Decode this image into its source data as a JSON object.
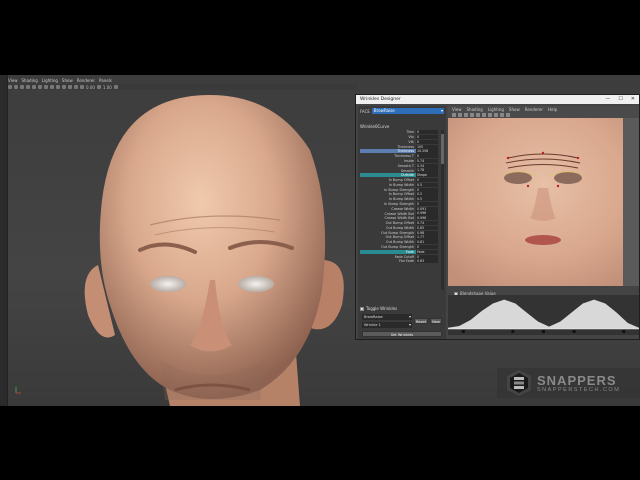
{
  "maya": {
    "menu": [
      "View",
      "Shading",
      "Lighting",
      "Show",
      "Renderer",
      "Panels"
    ],
    "toolbar_values": [
      "0.00",
      "1.00"
    ]
  },
  "designer": {
    "title": "Wrinkles Designer",
    "window_controls": [
      "—",
      "☐",
      "✕"
    ],
    "face_label": "FACE",
    "face_value": "BrowRaise",
    "wrinkles_header": "Wrinkle0Curve",
    "attributes": [
      {
        "name": "Tilex",
        "value": "0"
      },
      {
        "name": "Vtx",
        "value": "0"
      },
      {
        "name": "Vtk",
        "value": "0"
      },
      {
        "name": "Thickness",
        "value": "105"
      },
      {
        "name": "Thickness",
        "value": "10.256",
        "hl": true
      },
      {
        "name": "Thickness T",
        "value": "0"
      },
      {
        "name": "Inside",
        "value": "0.74"
      },
      {
        "name": "Smooth T",
        "value": "0.34"
      },
      {
        "name": "Smooth",
        "value": "1.78"
      },
      {
        "name": "Outside",
        "value": "Shape",
        "sec": true
      },
      {
        "name": "In Bump Offset",
        "value": "0"
      },
      {
        "name": "In Bump Width",
        "value": "0.5"
      },
      {
        "name": "In Bump Strength",
        "value": "0"
      },
      {
        "name": "In Bump Offset",
        "value": "0.2"
      },
      {
        "name": "In Bump Width",
        "value": "0.5"
      },
      {
        "name": "In Bump Strength",
        "value": "0"
      },
      {
        "name": "Crease Width",
        "value": "0.091"
      },
      {
        "name": "Crease Width Bot",
        "value": "0.996"
      },
      {
        "name": "Crease Width Bot",
        "value": "0.996"
      },
      {
        "name": "Out Bump Offset",
        "value": "0.74"
      },
      {
        "name": "Out Bump Width",
        "value": "0.85"
      },
      {
        "name": "Out Bump Strength",
        "value": "0.98"
      },
      {
        "name": "Out Bump Offset",
        "value": "1.77"
      },
      {
        "name": "Out Bump Width",
        "value": "0.81"
      },
      {
        "name": "Out Bump Strength",
        "value": "0"
      },
      {
        "name": "Fade",
        "value": "Fade",
        "sec": true
      },
      {
        "name": "Fade Cutoff",
        "value": "0"
      },
      {
        "name": "Fan Fade",
        "value": "0.83"
      }
    ],
    "toggle_label": "Toggle Wrinkles",
    "blendshape_label": "Blendshape Value",
    "select_face": "BrowRaise",
    "select_wrinkle": "Wrinkle 1",
    "btn_reset": "Reset",
    "btn_new": "New",
    "btn_set": "Set Wrinkles",
    "tex_menu": [
      "View",
      "Shading",
      "Lighting",
      "Show",
      "Renderer",
      "Help"
    ]
  },
  "graph": {
    "curve_levels": [
      0.04,
      0.1,
      0.3,
      0.6,
      0.85,
      0.98,
      0.85,
      0.55,
      0.25,
      0.08,
      0.25,
      0.55,
      0.85,
      0.98,
      0.85,
      0.55,
      0.2,
      0.04
    ]
  },
  "logo": {
    "brand": "SNAPPERS",
    "url": "SNAPPERSTECH.COM"
  },
  "colors": {
    "accent": "#2f6fb9",
    "section": "#2a8c91",
    "skin": "#d9a88c"
  }
}
